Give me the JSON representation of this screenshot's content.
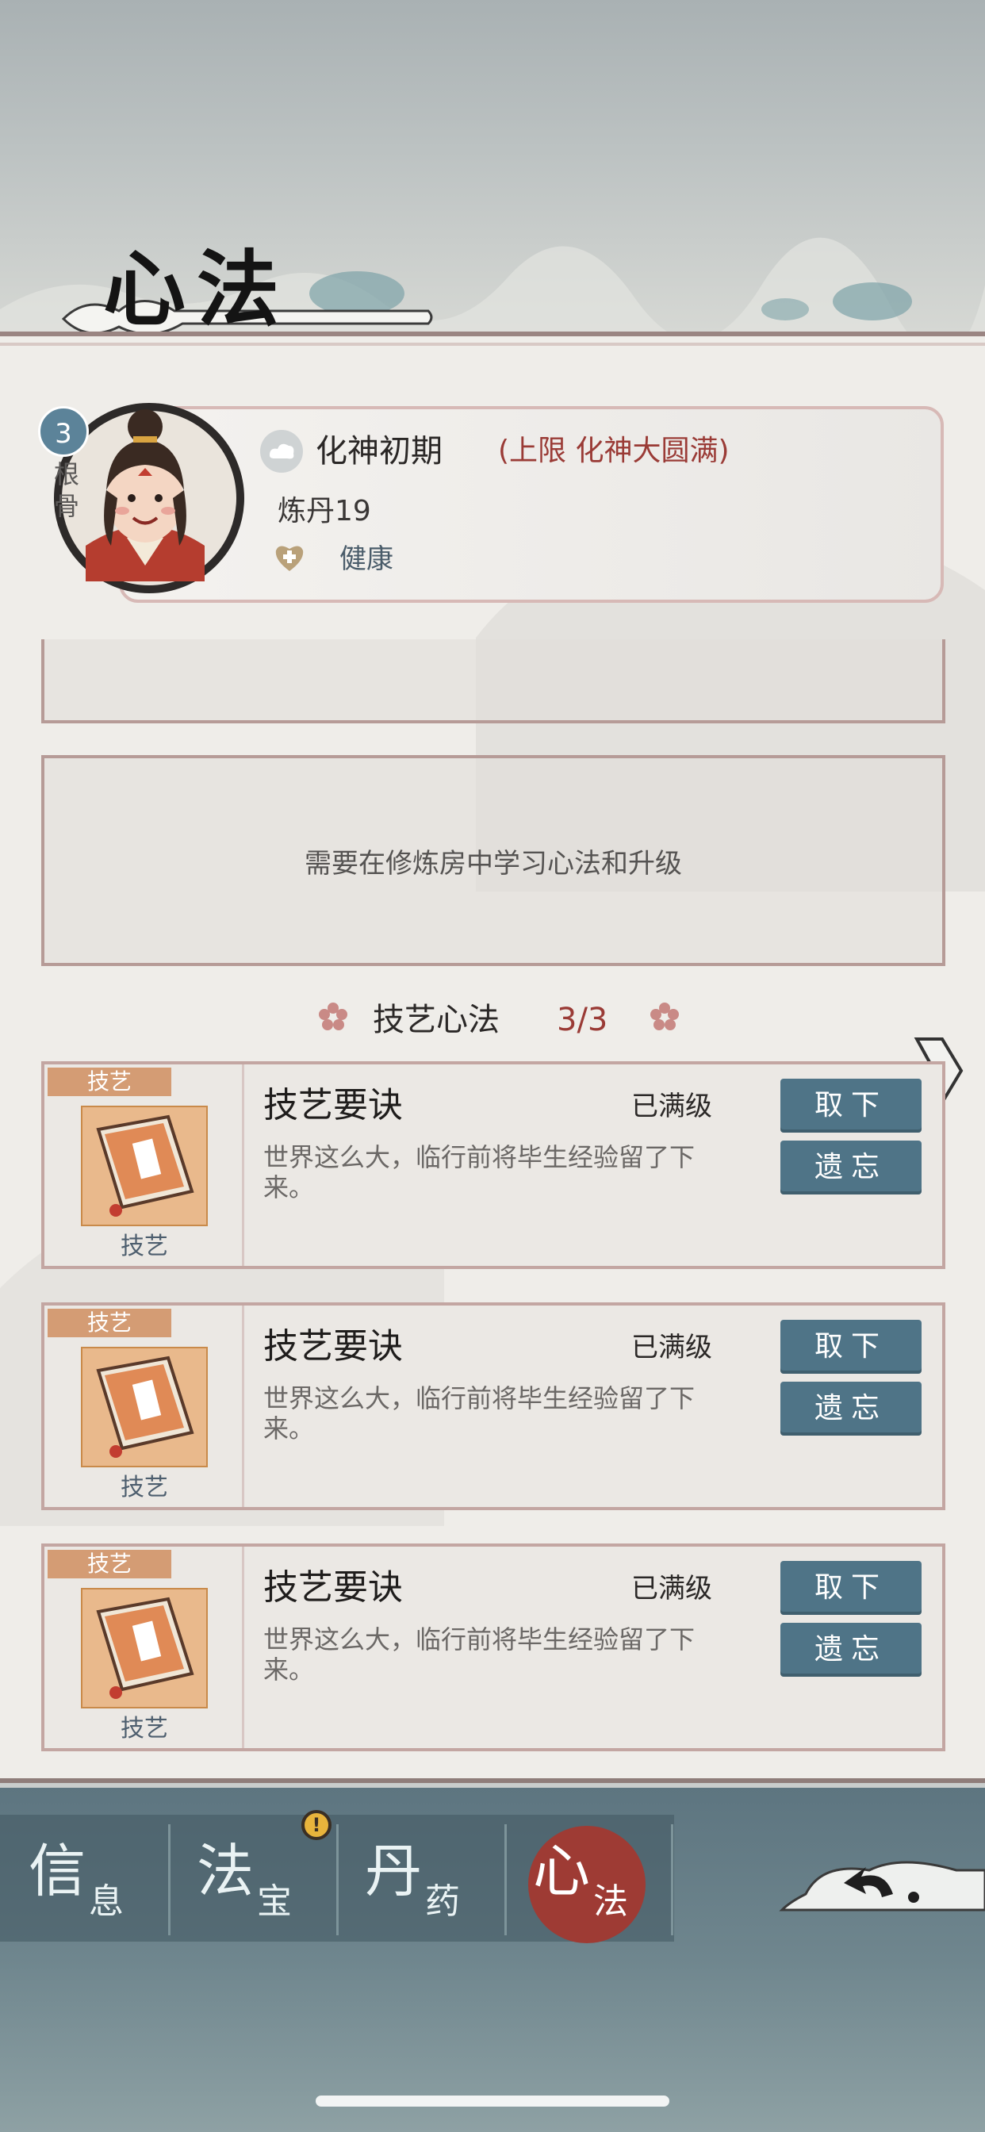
{
  "page": {
    "title": "心法"
  },
  "character": {
    "gen_value": "3",
    "gen_label": "根骨",
    "realm": "化神初期",
    "realm_limit": "(上限 化神大圆满)",
    "alchemy": "炼丹19",
    "status": "健康"
  },
  "empty_slot_hint": "需要在修炼房中学习心法和升级",
  "section": {
    "title": "技艺心法",
    "count": "3/3"
  },
  "skills": [
    {
      "tag": "技艺",
      "name": "技艺要诀",
      "level": "已满级",
      "description": "世界这么大，临行前将毕生经验留了下来。",
      "category": "技艺",
      "remove_label": "取下",
      "forget_label": "遗忘"
    },
    {
      "tag": "技艺",
      "name": "技艺要诀",
      "level": "已满级",
      "description": "世界这么大，临行前将毕生经验留了下来。",
      "category": "技艺",
      "remove_label": "取下",
      "forget_label": "遗忘"
    },
    {
      "tag": "技艺",
      "name": "技艺要诀",
      "level": "已满级",
      "description": "世界这么大，临行前将毕生经验留了下来。",
      "category": "技艺",
      "remove_label": "取下",
      "forget_label": "遗忘"
    }
  ],
  "tabs": [
    {
      "main": "信",
      "sub": "息",
      "active": false
    },
    {
      "main": "法",
      "sub": "宝",
      "active": false,
      "alert": "!"
    },
    {
      "main": "丹",
      "sub": "药",
      "active": false
    },
    {
      "main": "心",
      "sub": "法",
      "active": true
    }
  ],
  "colors": {
    "accent_red": "#9e3b34",
    "button_blue": "#4f7487",
    "tag_orange": "#d49c74"
  },
  "icons": [
    "realm-cloud-icon",
    "health-heart-icon",
    "flower-icon",
    "next-arrow-icon",
    "book-icon",
    "back-arrow-icon",
    "alert-icon"
  ]
}
